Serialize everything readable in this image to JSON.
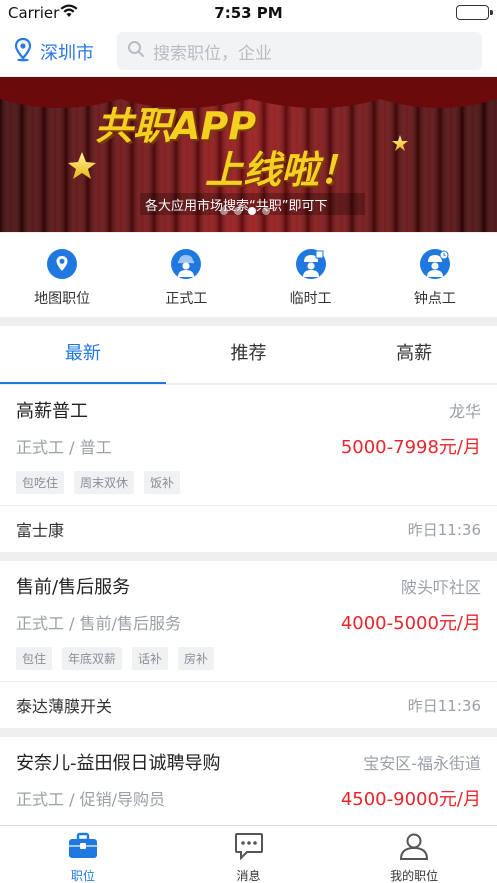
{
  "status_bar": {
    "carrier": "Carrier",
    "time": "7:53 PM"
  },
  "header": {
    "city": "深圳市",
    "search_placeholder": "搜索职位，企业"
  },
  "banner": {
    "title_line1": "共职APP",
    "title_line2": "上线啦！",
    "subtitle": "各大应用市场搜索“共职”即可下",
    "page_count": 4,
    "active_page": 2
  },
  "categories": [
    {
      "label": "地图职位",
      "icon": "map-person-icon"
    },
    {
      "label": "正式工",
      "icon": "worker-icon"
    },
    {
      "label": "临时工",
      "icon": "temp-worker-icon"
    },
    {
      "label": "钟点工",
      "icon": "hourly-worker-icon"
    }
  ],
  "tabs": [
    {
      "label": "最新",
      "active": true
    },
    {
      "label": "推荐",
      "active": false
    },
    {
      "label": "高薪",
      "active": false
    }
  ],
  "jobs": [
    {
      "title": "高薪普工",
      "area": "龙华",
      "type": "正式工 / 普工",
      "salary": "5000-7998元/月",
      "tags": [
        "包吃住",
        "周末双休",
        "饭补"
      ],
      "company": "富士康",
      "time": "昨日11:36"
    },
    {
      "title": "售前/售后服务",
      "area": "陂头吓社区",
      "type": "正式工 / 售前/售后服务",
      "salary": "4000-5000元/月",
      "tags": [
        "包住",
        "年底双薪",
        "话补",
        "房补"
      ],
      "company": "泰达薄膜开关",
      "time": "昨日11:36"
    },
    {
      "title": "安奈儿-益田假日诚聘导购",
      "area": "宝安区-福永街道",
      "type": "正式工 / 促销/导购员",
      "salary": "4500-9000元/月",
      "tags": [],
      "company": "",
      "time": ""
    }
  ],
  "bottom_nav": [
    {
      "label": "职位",
      "icon": "briefcase-icon",
      "active": true
    },
    {
      "label": "消息",
      "icon": "message-icon",
      "active": false
    },
    {
      "label": "我的职位",
      "icon": "user-icon",
      "active": false
    }
  ],
  "colors": {
    "accent": "#1f78e0",
    "salary": "#e8262b",
    "banner_bg": "#5a0708",
    "banner_text": "#f5d020"
  }
}
